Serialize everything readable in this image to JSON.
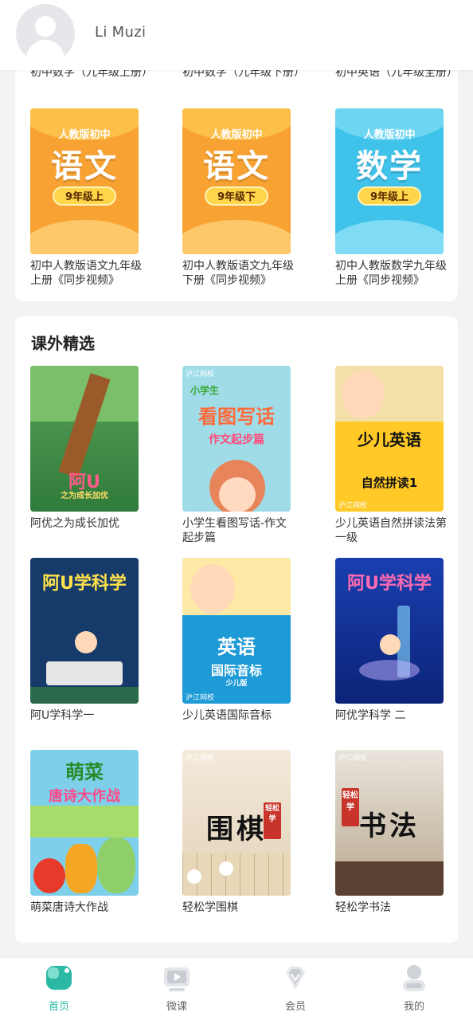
{
  "header": {
    "username": "Li Muzi"
  },
  "top_section": {
    "cut_titles": [
      "初中数学（九年级上册）",
      "初中数学（九年级下册）",
      "初中英语（九年级全册）"
    ],
    "items": [
      {
        "title": "初中人教版语文九年级上册《同步视频》",
        "cover": {
          "publisher": "人教版初中",
          "subject": "语文",
          "grade": "9年级上",
          "theme": "orange"
        }
      },
      {
        "title": "初中人教版语文九年级下册《同步视频》",
        "cover": {
          "publisher": "人教版初中",
          "subject": "语文",
          "grade": "9年级下",
          "theme": "orange"
        }
      },
      {
        "title": "初中人教版数学九年级上册《同步视频》",
        "cover": {
          "publisher": "人教版初中",
          "subject": "数学",
          "grade": "9年级上",
          "theme": "blue"
        }
      }
    ]
  },
  "extra_section": {
    "title": "课外精选",
    "items": [
      {
        "title": "阿优之为成长加优",
        "cover_text": "阿U",
        "cover_sub": "之为成长加优"
      },
      {
        "title": "小学生看图写话-作文起步篇",
        "cover_text": "看图写话",
        "cover_sub": "作文起步篇",
        "cover_tag": "小学生",
        "brand": "沪江网校"
      },
      {
        "title": "少儿英语自然拼读法第一级",
        "cover_text": "少儿英语",
        "cover_sub": "自然拼读1",
        "brand": "沪江网校"
      },
      {
        "title": "阿U学科学一",
        "cover_text": "阿U学科学"
      },
      {
        "title": "少儿英语国际音标",
        "cover_text": "英语",
        "cover_sub": "国际音标",
        "cover_tag": "少儿版",
        "brand": "沪江网校"
      },
      {
        "title": "阿优学科学 二",
        "cover_text": "阿U学科学"
      },
      {
        "title": "萌菜唐诗大作战",
        "cover_text": "萌菜",
        "cover_sub": "唐诗大作战"
      },
      {
        "title": "轻松学围棋",
        "cover_text": "围棋",
        "cover_tag": "轻松学",
        "brand": "沪江网校"
      },
      {
        "title": "轻松学书法",
        "cover_text": "书法",
        "cover_tag": "轻松学",
        "brand": "沪江网校"
      }
    ]
  },
  "tabbar": {
    "tabs": [
      {
        "label": "首页",
        "icon": "home-icon",
        "active": true
      },
      {
        "label": "微课",
        "icon": "video-icon",
        "active": false
      },
      {
        "label": "会员",
        "icon": "diamond-icon",
        "active": false
      },
      {
        "label": "我的",
        "icon": "profile-icon",
        "active": false
      }
    ]
  },
  "colors": {
    "accent": "#2bb9a4",
    "orange_cover": "#f7a233",
    "blue_cover": "#3fc3ea"
  }
}
